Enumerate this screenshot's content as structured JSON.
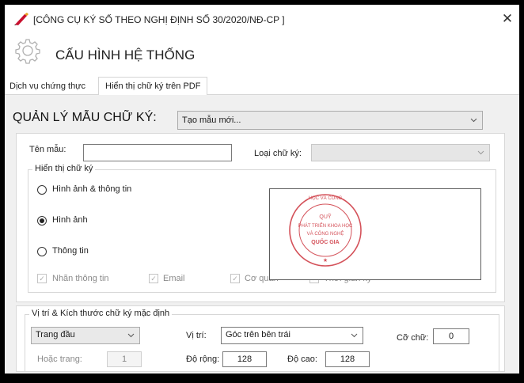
{
  "window": {
    "title": "[CÔNG CỤ KÝ SỐ THEO NGHỊ ĐỊNH SỐ 30/2020/NĐ-CP ]",
    "close_glyph": "✕"
  },
  "header": {
    "title": "CẤU HÌNH HỆ THỐNG"
  },
  "tabs": [
    {
      "label": "Dịch vụ chứng thực"
    },
    {
      "label": "Hiển thị chữ ký trên PDF"
    }
  ],
  "manager": {
    "label": "QUẢN LÝ MẪU CHỮ KÝ:",
    "selected": "Tạo mẫu mới..."
  },
  "form": {
    "name_label": "Tên mẫu:",
    "name_value": "",
    "type_label": "Loại chữ ký:",
    "type_value": ""
  },
  "display_group": {
    "legend": "Hiển thị chữ ký",
    "options": [
      {
        "label": "Hình ảnh & thông tin",
        "selected": false
      },
      {
        "label": "Hình ảnh",
        "selected": true
      },
      {
        "label": "Thông tin",
        "selected": false
      }
    ],
    "checkboxes": [
      {
        "label": "Nhãn thông tin",
        "checked": true
      },
      {
        "label": "Email",
        "checked": true
      },
      {
        "label": "Cơ quan",
        "checked": true
      },
      {
        "label": "Thời gian ký",
        "checked": true
      }
    ]
  },
  "stamp": {
    "top_text": "HỌC VÀ CÔNG",
    "line1": "QUỸ",
    "line2": "PHÁT TRIỂN KHOA HỌC",
    "line3": "VÀ CÔNG NGHỆ",
    "line4": "QUỐC GIA",
    "color": "#d4525a"
  },
  "position_group": {
    "legend": "Vị trí & Kích thước chữ ký mặc định",
    "page_value": "Trang đầu",
    "position_label": "Vị trí:",
    "position_value": "Góc trên bên trái",
    "font_size_label": "Cỡ chữ:",
    "font_size_value": "0",
    "or_page_label": "Hoặc trang:",
    "or_page_value": "1",
    "width_label": "Độ rộng:",
    "width_value": "128",
    "height_label": "Độ cao:",
    "height_value": "128"
  },
  "colors": {
    "accent": "#0a6cd6",
    "logo": "#c8102e"
  }
}
